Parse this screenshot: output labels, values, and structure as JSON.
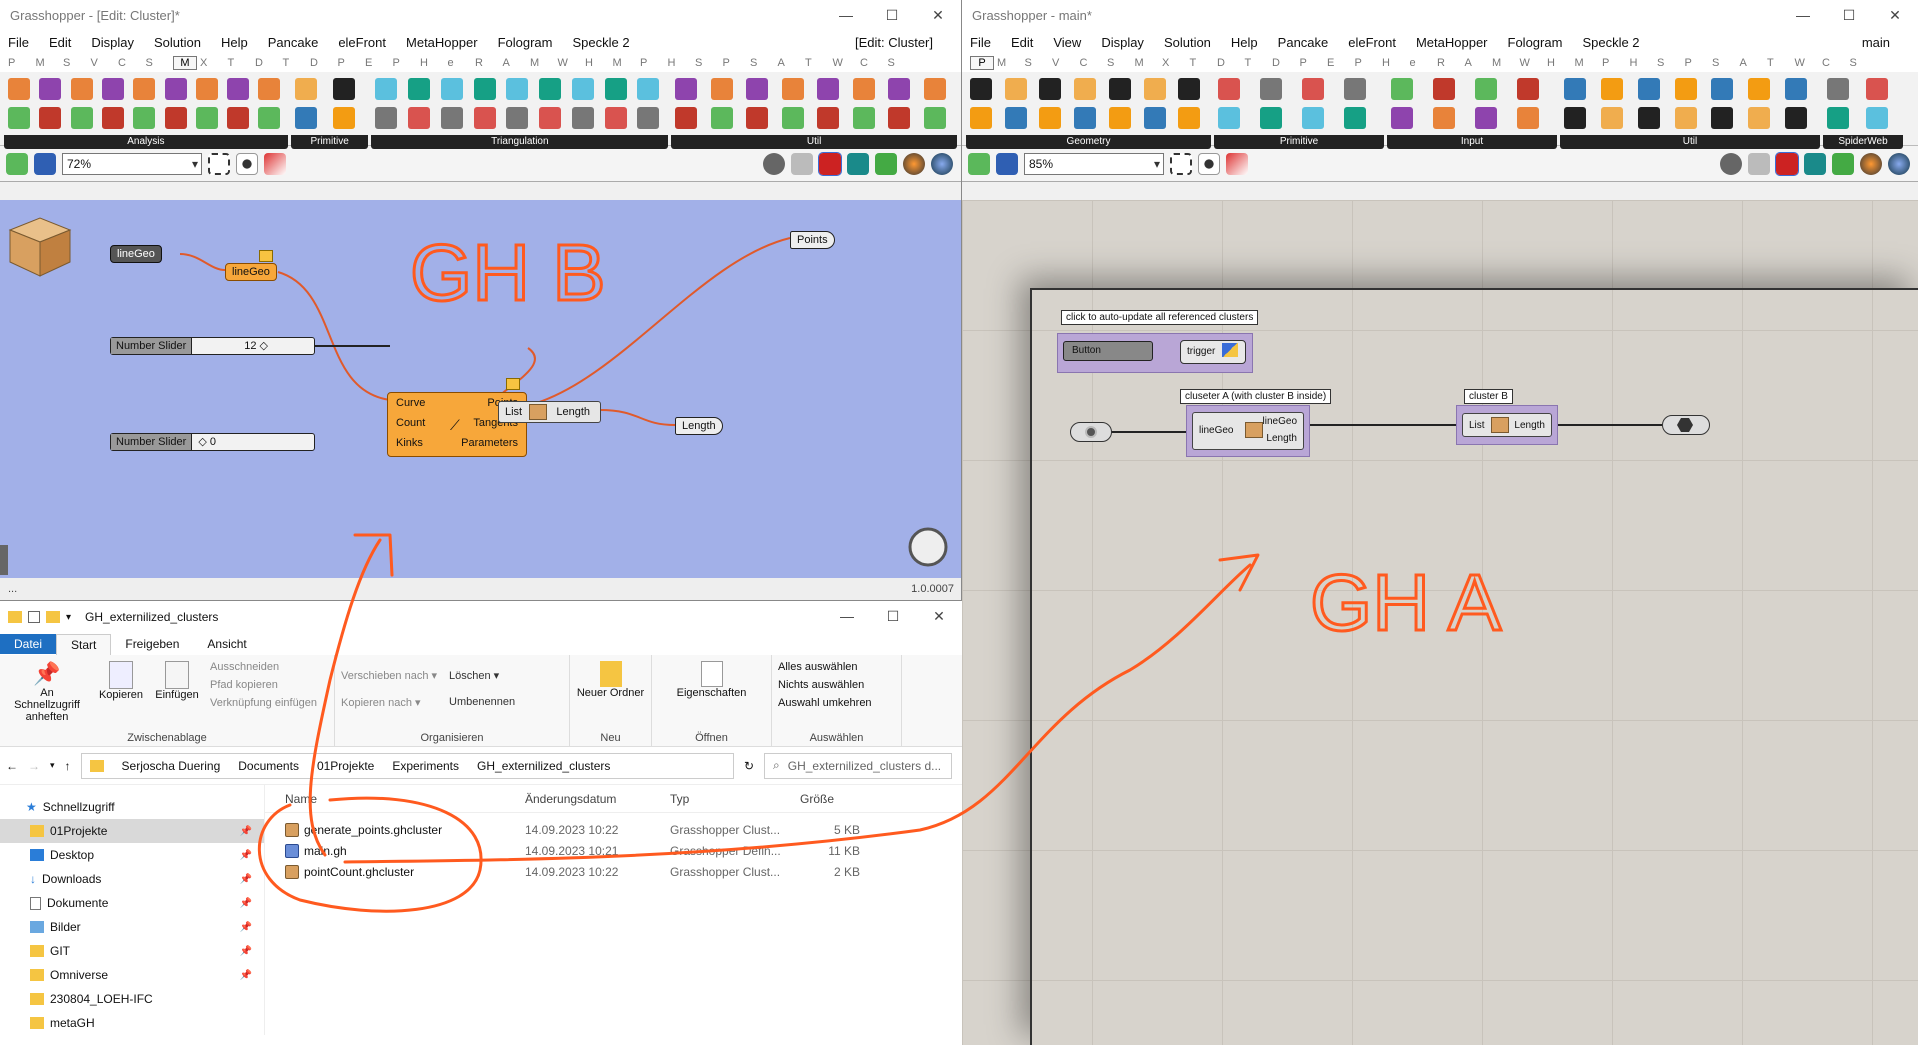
{
  "left": {
    "title": "Grasshopper - [Edit: Cluster]*",
    "edit_tag": "[Edit: Cluster]",
    "menu": [
      "File",
      "Edit",
      "Display",
      "Solution",
      "Help",
      "Pancake",
      "eleFront",
      "MetaHopper",
      "Fologram",
      "Speckle 2"
    ],
    "tabs": [
      "P",
      "M",
      "S",
      "V",
      "C",
      "S",
      "M",
      "X",
      "T",
      "D",
      "T",
      "D",
      "P",
      "E",
      "P",
      "H",
      "e",
      "R",
      "A",
      "M",
      "W",
      "H",
      "M",
      "P",
      "H",
      "S",
      "P",
      "S",
      "A",
      "T",
      "W",
      "C",
      "S"
    ],
    "active_tab": "M",
    "groups": [
      "Analysis",
      "Primitive",
      "Triangulation",
      "Util"
    ],
    "zoom": "72%",
    "version": "1.0.0007",
    "status_left": "...",
    "canvas": {
      "linegeo_param": "lineGeo",
      "linegeo_cluster": "lineGeo",
      "points_out": "Points",
      "comp_inputs": [
        "Curve",
        "Count",
        "Kinks"
      ],
      "comp_outputs": [
        "Points",
        "Tangents",
        "Parameters"
      ],
      "slider1_label": "Number Slider",
      "slider1_value": "12 ◇",
      "slider2_label": "Number Slider",
      "slider2_value": "◇ 0",
      "list_length_in": "List",
      "list_length_out": "Length",
      "length_out": "Length"
    }
  },
  "right": {
    "title": "Grasshopper - main*",
    "main_tag": "main",
    "menu": [
      "File",
      "Edit",
      "View",
      "Display",
      "Solution",
      "Help",
      "Pancake",
      "eleFront",
      "MetaHopper",
      "Fologram",
      "Speckle 2"
    ],
    "tabs": [
      "P",
      "M",
      "S",
      "V",
      "C",
      "S",
      "M",
      "X",
      "T",
      "D",
      "T",
      "D",
      "P",
      "E",
      "P",
      "H",
      "e",
      "R",
      "A",
      "M",
      "W",
      "H",
      "M",
      "P",
      "H",
      "S",
      "P",
      "S",
      "A",
      "T",
      "W",
      "C",
      "S"
    ],
    "active_tab": "P",
    "groups": [
      "Geometry",
      "Primitive",
      "Input",
      "Util",
      "SpiderWeb"
    ],
    "zoom": "85%",
    "canvas": {
      "group1_label": "click to auto-update all referenced clusters",
      "button": "Button",
      "trigger": "trigger",
      "group2_label": "cluseter A (with cluster B inside)",
      "clusterA_in": "lineGeo",
      "clusterA_out1": "lineGeo",
      "clusterA_out2": "Length",
      "group3_label": "cluster B",
      "clusterB_in": "List",
      "clusterB_out": "Length"
    }
  },
  "annotations": {
    "gh_b": "GH B",
    "gh_a": "GH A"
  },
  "explorer": {
    "title": "GH_externilized_clusters",
    "tabs": [
      "Datei",
      "Start",
      "Freigeben",
      "Ansicht"
    ],
    "ribbon": {
      "pin": "An Schnellzugriff anheften",
      "copy": "Kopieren",
      "paste": "Einfügen",
      "cut": "Ausschneiden",
      "copy_path": "Pfad kopieren",
      "paste_link": "Verknüpfung einfügen",
      "g1": "Zwischenablage",
      "move": "Verschieben nach ▾",
      "copy_to": "Kopieren nach ▾",
      "delete": "Löschen ▾",
      "rename": "Umbenennen",
      "g2": "Organisieren",
      "new_folder": "Neuer Ordner",
      "g3": "Neu",
      "props": "Eigenschaften",
      "g4": "Öffnen",
      "sel_all": "Alles auswählen",
      "sel_none": "Nichts auswählen",
      "sel_inv": "Auswahl umkehren",
      "g5": "Auswählen"
    },
    "path": [
      "Serjoscha Duering",
      "Documents",
      "01Projekte",
      "Experiments",
      "GH_externilized_clusters"
    ],
    "search": "GH_externilized_clusters d...",
    "nav": [
      {
        "label": "Schnellzugriff",
        "pin": false
      },
      {
        "label": "01Projekte",
        "pin": true
      },
      {
        "label": "Desktop",
        "pin": true
      },
      {
        "label": "Downloads",
        "pin": true
      },
      {
        "label": "Dokumente",
        "pin": true
      },
      {
        "label": "Bilder",
        "pin": true
      },
      {
        "label": "GIT",
        "pin": true
      },
      {
        "label": "Omniverse",
        "pin": true
      },
      {
        "label": "230804_LOEH-IFC",
        "pin": false
      },
      {
        "label": "metaGH",
        "pin": false
      }
    ],
    "columns": [
      "Name",
      "Änderungsdatum",
      "Typ",
      "Größe"
    ],
    "files": [
      {
        "name": "generate_points.ghcluster",
        "date": "14.09.2023 10:22",
        "type": "Grasshopper Clust...",
        "size": "5 KB"
      },
      {
        "name": "main.gh",
        "date": "14.09.2023 10:21",
        "type": "Grasshopper Defin...",
        "size": "11 KB"
      },
      {
        "name": "pointCount.ghcluster",
        "date": "14.09.2023 10:22",
        "type": "Grasshopper Clust...",
        "size": "2 KB"
      }
    ]
  }
}
